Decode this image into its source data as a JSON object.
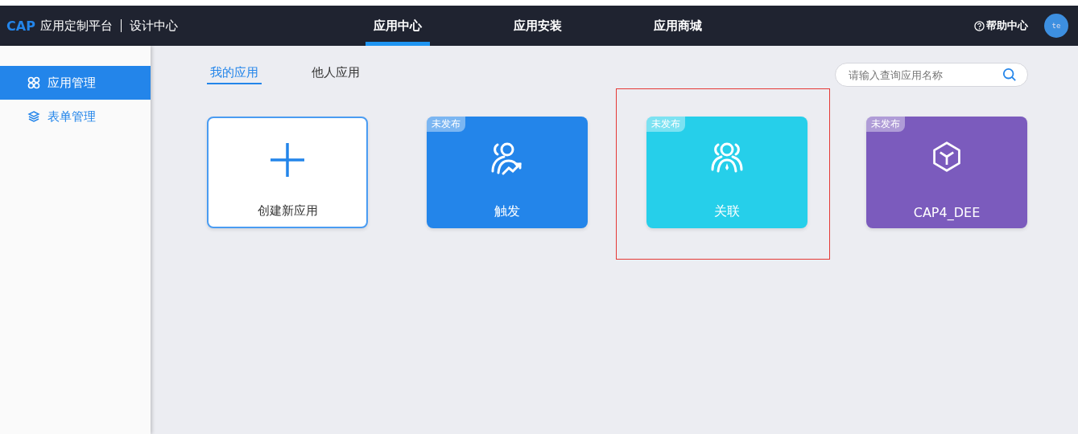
{
  "header": {
    "logo": "CAP",
    "title": "应用定制平台",
    "subtitle": "设计中心",
    "nav": [
      {
        "label": "应用中心",
        "selected": true
      },
      {
        "label": "应用安装",
        "selected": false
      },
      {
        "label": "应用商城",
        "selected": false
      }
    ],
    "help": "帮助中心",
    "avatar": "te"
  },
  "sidebar": {
    "items": [
      {
        "label": "应用管理",
        "selected": true
      },
      {
        "label": "表单管理",
        "selected": false
      }
    ]
  },
  "tabs": [
    {
      "label": "我的应用",
      "selected": true
    },
    {
      "label": "他人应用",
      "selected": false
    }
  ],
  "search": {
    "placeholder": "请输入查询应用名称"
  },
  "cards": [
    {
      "kind": "create",
      "name": "创建新应用",
      "highlighted": false
    },
    {
      "kind": "app",
      "name": "触发",
      "badge": "未发布",
      "color": "#2385ea",
      "highlighted": false
    },
    {
      "kind": "app",
      "name": "关联",
      "badge": "未发布",
      "color": "#26cfea",
      "highlighted": true
    },
    {
      "kind": "app",
      "name": "CAP4_DEE",
      "badge": "未发布",
      "color": "#7b5bbd",
      "highlighted": false
    }
  ]
}
